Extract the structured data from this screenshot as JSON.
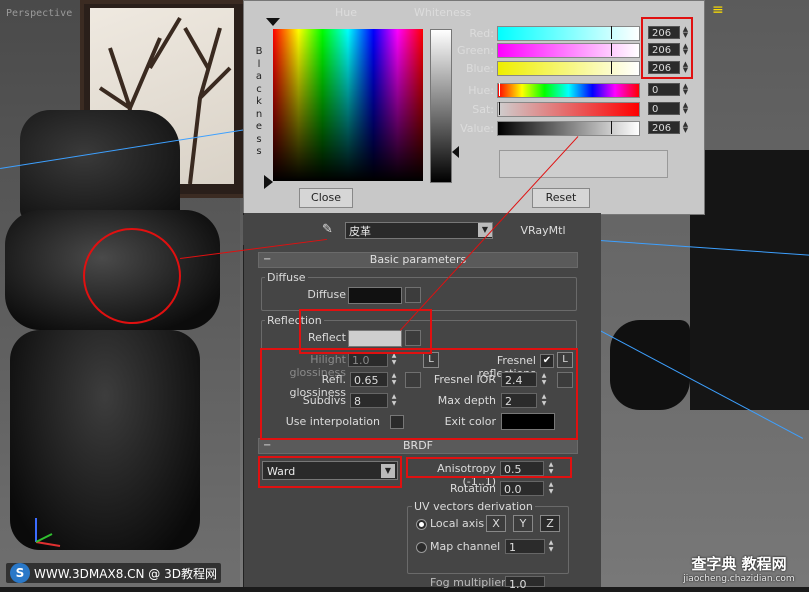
{
  "viewport": {
    "label": "Perspective"
  },
  "color_selector": {
    "hue_label": "Hue",
    "whiteness_label": "Whiteness",
    "blackness_label": "Blackness",
    "sliders": [
      {
        "label": "Red:",
        "value": "206"
      },
      {
        "label": "Green:",
        "value": "206"
      },
      {
        "label": "Blue:",
        "value": "206"
      },
      {
        "label": "Hue:",
        "value": "0"
      },
      {
        "label": "Sat:",
        "value": "0"
      },
      {
        "label": "Value:",
        "value": "206"
      }
    ],
    "close_label": "Close",
    "reset_label": "Reset",
    "current_color": "#cecece"
  },
  "material": {
    "name": "皮革",
    "type": "VRayMtl",
    "basic_parameters_label": "Basic parameters",
    "diffuse_group": "Diffuse",
    "diffuse_label": "Diffuse",
    "reflection_group": "Reflection",
    "reflect_label": "Reflect",
    "hilight_label": "Hilight glossiness",
    "hilight_value": "1.0",
    "fresnel_label": "Fresnel reflections",
    "fresnel_checked": "✔",
    "l_label": "L",
    "refl_gloss_label": "Refl. glossiness",
    "refl_gloss_value": "0.65",
    "fresnel_ior_label": "Fresnel IOR",
    "fresnel_ior_value": "2.4",
    "subdivs_label": "Subdivs",
    "subdivs_value": "8",
    "max_depth_label": "Max depth",
    "max_depth_value": "2",
    "use_interp_label": "Use interpolation",
    "exit_color_label": "Exit color",
    "brdf_label": "BRDF",
    "brdf_type": "Ward",
    "anisotropy_label": "Anisotropy (-1..1)",
    "anisotropy_value": "0.5",
    "rotation_label": "Rotation",
    "rotation_value": "0.0",
    "uv_group": "UV vectors derivation",
    "local_axis_label": "Local axis",
    "axes": [
      "X",
      "Y",
      "Z"
    ],
    "map_channel_label": "Map channel",
    "map_channel_value": "1",
    "fog_multiplier_label": "Fog multiplier",
    "fog_multiplier_value": "1.0"
  },
  "watermark_left": {
    "logo": "S",
    "text": "WWW.3DMAX8.CN @ 3D教程网"
  },
  "watermark_right": {
    "line1": "查字典 教程网",
    "line2": "jiaocheng.chazidian.com"
  }
}
